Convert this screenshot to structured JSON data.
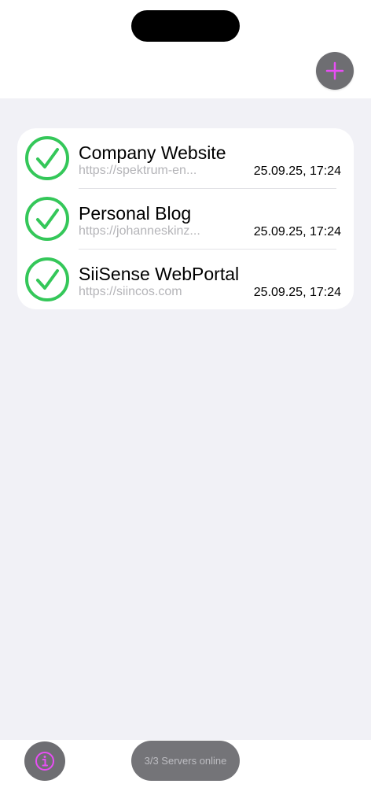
{
  "header": {
    "add_icon": "plus-icon",
    "accent": "#e84ef5"
  },
  "servers": [
    {
      "name": "Company Website",
      "url": "https://spektrum-en...",
      "timestamp": "25.09.25, 17:24",
      "status_icon": "checkmark-circle-icon",
      "status_color": "#34c759"
    },
    {
      "name": "Personal Blog",
      "url": "https://johanneskinz...",
      "timestamp": "25.09.25, 17:24",
      "status_icon": "checkmark-circle-icon",
      "status_color": "#34c759"
    },
    {
      "name": "SiiSense WebPortal",
      "url": "https://siincos.com",
      "timestamp": "25.09.25, 17:24",
      "status_icon": "checkmark-circle-icon",
      "status_color": "#34c759"
    }
  ],
  "footer": {
    "info_icon": "info-icon",
    "status_text": "3/3 Servers online"
  }
}
